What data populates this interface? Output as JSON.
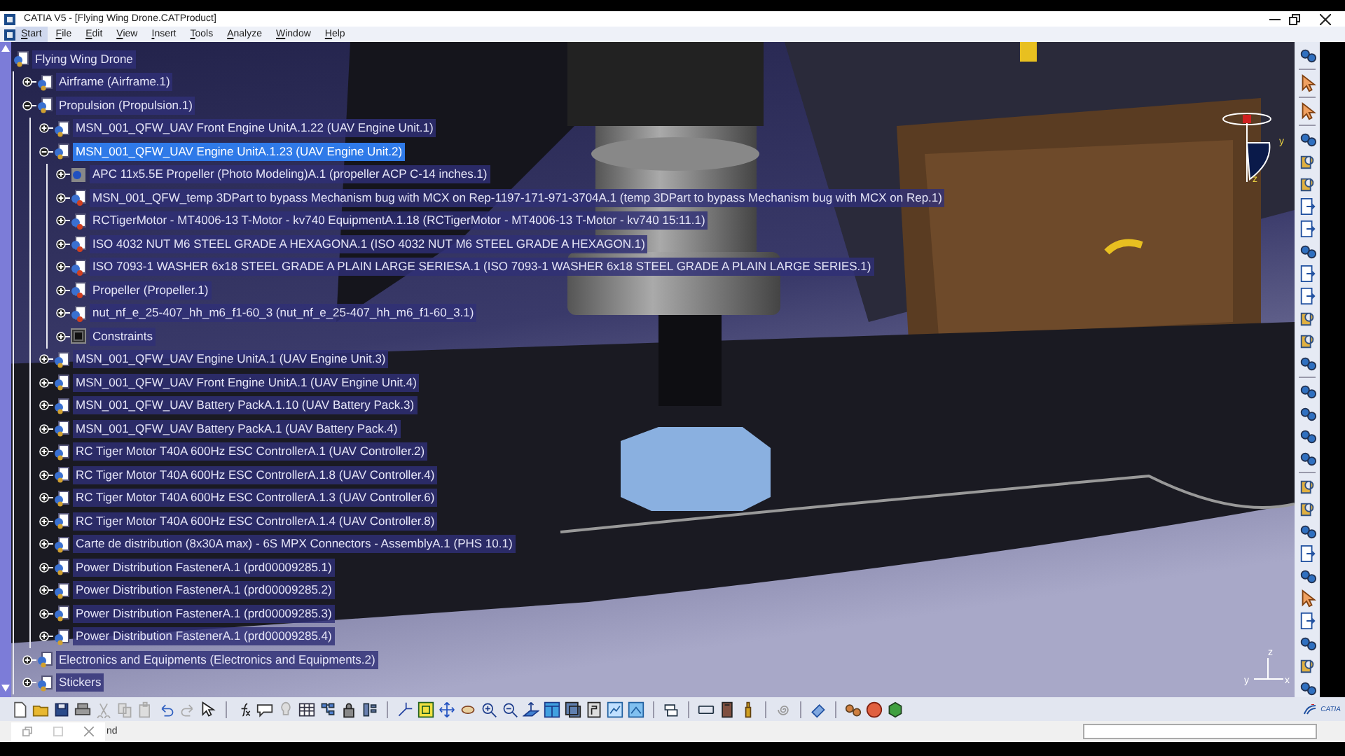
{
  "window": {
    "title": "CATIA V5 - [Flying Wing Drone.CATProduct]"
  },
  "menu": [
    {
      "label": "Start",
      "selected": true
    },
    {
      "label": "File",
      "selected": false
    },
    {
      "label": "Edit",
      "selected": false
    },
    {
      "label": "View",
      "selected": false
    },
    {
      "label": "Insert",
      "selected": false
    },
    {
      "label": "Tools",
      "selected": false
    },
    {
      "label": "Analyze",
      "selected": false
    },
    {
      "label": "Window",
      "selected": false
    },
    {
      "label": "Help",
      "selected": false
    }
  ],
  "tree": {
    "root": {
      "label": "Flying Wing Drone",
      "kind": "product",
      "selected": false,
      "children": [
        {
          "label": "Airframe (Airframe.1)",
          "kind": "product",
          "expanded": false,
          "selected": false
        },
        {
          "label": "Propulsion (Propulsion.1)",
          "kind": "product",
          "expanded": true,
          "selected": false,
          "children": [
            {
              "label": "MSN_001_QFW_UAV Front Engine UnitA.1.22 (UAV Engine Unit.1)",
              "kind": "product",
              "expanded": false,
              "selected": false
            },
            {
              "label": "MSN_001_QFW_UAV Engine UnitA.1.23 (UAV Engine Unit.2)",
              "kind": "product",
              "expanded": true,
              "selected": true,
              "children": [
                {
                  "label": "APC 11x5.5E Propeller (Photo Modeling)A.1 (propeller ACP C-14 inches.1)",
                  "kind": "photo",
                  "expanded": false,
                  "selected": false
                },
                {
                  "label": "MSN_001_QFW_temp 3DPart to bypass Mechanism bug with MCX on Rep-1197-171-971-3704A.1 (temp 3DPart to bypass Mechanism bug with MCX on Rep.1)",
                  "kind": "part",
                  "expanded": false,
                  "selected": false
                },
                {
                  "label": "RCTigerMotor - MT4006-13 T-Motor - kv740 EquipmentA.1.18 (RCTigerMotor - MT4006-13 T-Motor - kv740 15:11.1)",
                  "kind": "part",
                  "expanded": false,
                  "selected": false
                },
                {
                  "label": "ISO 4032 NUT M6 STEEL GRADE A HEXAGONA.1 (ISO 4032 NUT M6 STEEL GRADE A HEXAGON.1)",
                  "kind": "part",
                  "expanded": false,
                  "selected": false
                },
                {
                  "label": "ISO 7093-1 WASHER 6x18 STEEL GRADE A PLAIN LARGE SERIESA.1 (ISO 7093-1 WASHER 6x18 STEEL GRADE A PLAIN LARGE SERIES.1)",
                  "kind": "part",
                  "expanded": false,
                  "selected": false
                },
                {
                  "label": "Propeller (Propeller.1)",
                  "kind": "part",
                  "expanded": false,
                  "selected": false
                },
                {
                  "label": "nut_nf_e_25-407_hh_m6_f1-60_3 (nut_nf_e_25-407_hh_m6_f1-60_3.1)",
                  "kind": "part",
                  "expanded": false,
                  "selected": false
                },
                {
                  "label": "Constraints",
                  "kind": "constraints",
                  "expanded": false,
                  "selected": false
                }
              ]
            },
            {
              "label": "MSN_001_QFW_UAV Engine UnitA.1 (UAV Engine Unit.3)",
              "kind": "product",
              "expanded": false,
              "selected": false
            },
            {
              "label": "MSN_001_QFW_UAV Front Engine UnitA.1 (UAV Engine Unit.4)",
              "kind": "product",
              "expanded": false,
              "selected": false
            },
            {
              "label": "MSN_001_QFW_UAV Battery PackA.1.10 (UAV Battery Pack.3)",
              "kind": "product",
              "expanded": false,
              "selected": false
            },
            {
              "label": "MSN_001_QFW_UAV Battery PackA.1 (UAV Battery Pack.4)",
              "kind": "product",
              "expanded": false,
              "selected": false
            },
            {
              "label": "RC Tiger Motor T40A 600Hz ESC ControllerA.1 (UAV Controller.2)",
              "kind": "product",
              "expanded": false,
              "selected": false
            },
            {
              "label": "RC Tiger Motor T40A 600Hz ESC ControllerA.1.8 (UAV Controller.4)",
              "kind": "product",
              "expanded": false,
              "selected": false
            },
            {
              "label": "RC Tiger Motor T40A 600Hz ESC ControllerA.1.3 (UAV Controller.6)",
              "kind": "product",
              "expanded": false,
              "selected": false
            },
            {
              "label": "RC Tiger Motor T40A 600Hz ESC ControllerA.1.4 (UAV Controller.8)",
              "kind": "product",
              "expanded": false,
              "selected": false
            },
            {
              "label": "Carte de distribution (8x30A max) - 6S MPX Connectors - AssemblyA.1 (PHS 10.1)",
              "kind": "product",
              "expanded": false,
              "selected": false
            },
            {
              "label": "Power Distribution FastenerA.1 (prd00009285.1)",
              "kind": "product",
              "expanded": false,
              "selected": false
            },
            {
              "label": "Power Distribution FastenerA.1 (prd00009285.2)",
              "kind": "product",
              "expanded": false,
              "selected": false
            },
            {
              "label": "Power Distribution FastenerA.1 (prd00009285.3)",
              "kind": "product",
              "expanded": false,
              "selected": false
            },
            {
              "label": "Power Distribution FastenerA.1 (prd00009285.4)",
              "kind": "product",
              "expanded": false,
              "selected": false
            }
          ]
        },
        {
          "label": "Electronics and Equipments (Electronics and Equipments.2)",
          "kind": "product",
          "expanded": false,
          "selected": false
        },
        {
          "label": "Stickers",
          "kind": "product",
          "expanded": false,
          "selected": false
        }
      ]
    }
  },
  "viewport": {
    "compass_labels": [
      "y",
      "z"
    ],
    "axis_labels": [
      "z",
      "y",
      "x"
    ]
  },
  "brand": "CATIA",
  "status_bar": {
    "text": "nd"
  }
}
